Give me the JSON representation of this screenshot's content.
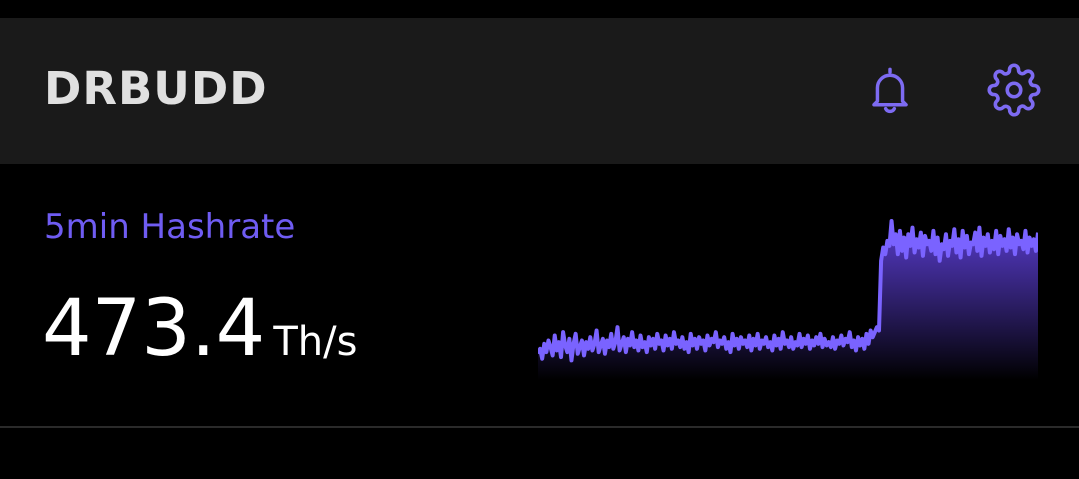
{
  "header": {
    "title": "DRBUDD",
    "icons": [
      "bell-icon",
      "gear-icon"
    ],
    "accent_color": "#7d6bf2"
  },
  "hashrate": {
    "label": "5min Hashrate",
    "value": "473.4",
    "unit": "Th/s",
    "label_color": "#6f5cf2",
    "line_color": "#7a63ff",
    "fill_top_color": "#5d3fd8",
    "fill_bottom_color": "#000000"
  },
  "chart_data": {
    "type": "area",
    "title": "",
    "xlabel": "",
    "ylabel": "",
    "grid": false,
    "legend": "none",
    "ylim": [
      0,
      100
    ],
    "values": [
      14,
      17,
      11,
      20,
      15,
      22,
      18,
      13,
      25,
      16,
      21,
      12,
      27,
      19,
      15,
      23,
      10,
      20,
      26,
      14,
      18,
      22,
      13,
      21,
      17,
      24,
      16,
      20,
      28,
      15,
      19,
      23,
      14,
      22,
      18,
      26,
      17,
      21,
      30,
      16,
      20,
      24,
      15,
      23,
      19,
      27,
      18,
      22,
      16,
      25,
      18,
      21,
      15,
      24,
      19,
      23,
      17,
      26,
      20,
      22,
      16,
      25,
      19,
      23,
      17,
      27,
      20,
      22,
      18,
      24,
      17,
      21,
      15,
      26,
      19,
      23,
      17,
      24,
      20,
      22,
      16,
      25,
      19,
      23,
      21,
      27,
      18,
      22,
      20,
      24,
      17,
      21,
      15,
      26,
      19,
      23,
      17,
      24,
      20,
      22,
      18,
      25,
      16,
      23,
      19,
      26,
      17,
      22,
      20,
      24,
      18,
      21,
      16,
      25,
      19,
      23,
      17,
      27,
      20,
      22,
      18,
      24,
      17,
      21,
      19,
      26,
      18,
      23,
      20,
      25,
      17,
      22,
      19,
      24,
      20,
      26,
      18,
      23,
      19,
      21,
      18,
      24,
      17,
      22,
      20,
      25,
      19,
      23,
      21,
      27,
      18,
      22,
      16,
      24,
      19,
      23,
      17,
      26,
      20,
      28,
      24,
      27,
      30,
      28,
      70,
      78,
      74,
      82,
      79,
      94,
      80,
      86,
      74,
      88,
      76,
      84,
      72,
      86,
      79,
      90,
      75,
      83,
      78,
      87,
      73,
      85,
      80,
      82,
      76,
      88,
      74,
      84,
      70,
      80,
      77,
      86,
      73,
      82,
      79,
      89,
      75,
      83,
      72,
      88,
      78,
      85,
      74,
      81,
      80,
      87,
      76,
      90,
      73,
      84,
      79,
      86,
      75,
      82,
      77,
      88,
      74,
      85,
      79,
      83,
      76,
      89,
      78,
      84,
      74,
      86,
      80,
      82,
      77,
      88,
      75,
      84,
      79,
      83,
      76,
      87
    ]
  }
}
